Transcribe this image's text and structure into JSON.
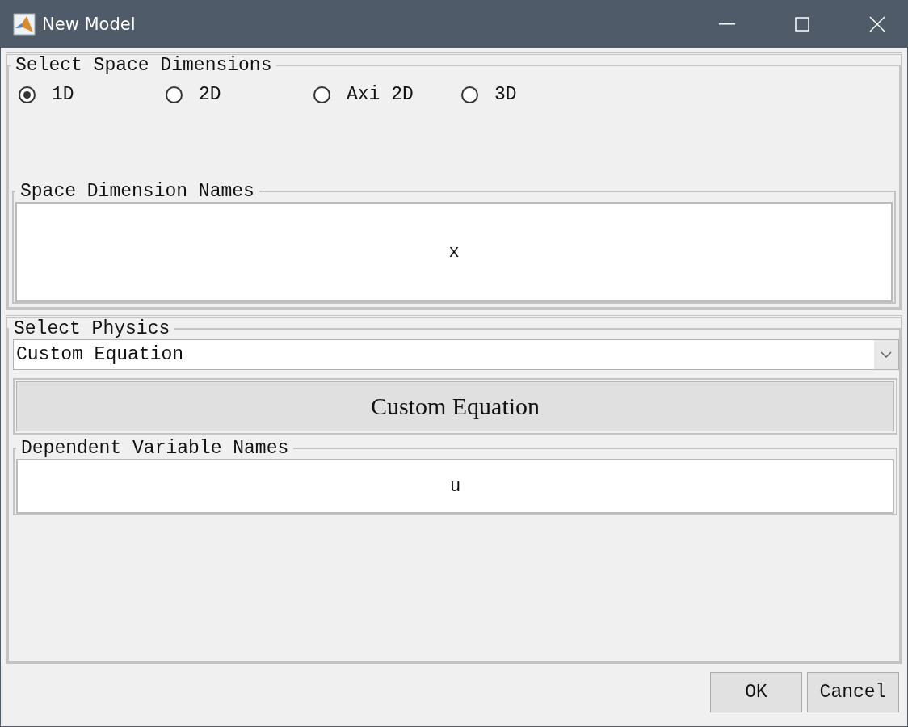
{
  "window": {
    "title": "New Model"
  },
  "space_dimensions": {
    "title": "Select Space Dimensions",
    "options": [
      {
        "label": "1D",
        "selected": true
      },
      {
        "label": "2D",
        "selected": false
      },
      {
        "label": "Axi 2D",
        "selected": false
      },
      {
        "label": "3D",
        "selected": false
      }
    ],
    "names_title": "Space Dimension Names",
    "names_value": "x"
  },
  "physics": {
    "title": "Select Physics",
    "dropdown_value": "Custom Equation",
    "button": "Custom Equation",
    "variables_title": "Dependent Variable Names",
    "variables_value": "u"
  },
  "buttons": [
    "OK",
    "Cancel"
  ]
}
